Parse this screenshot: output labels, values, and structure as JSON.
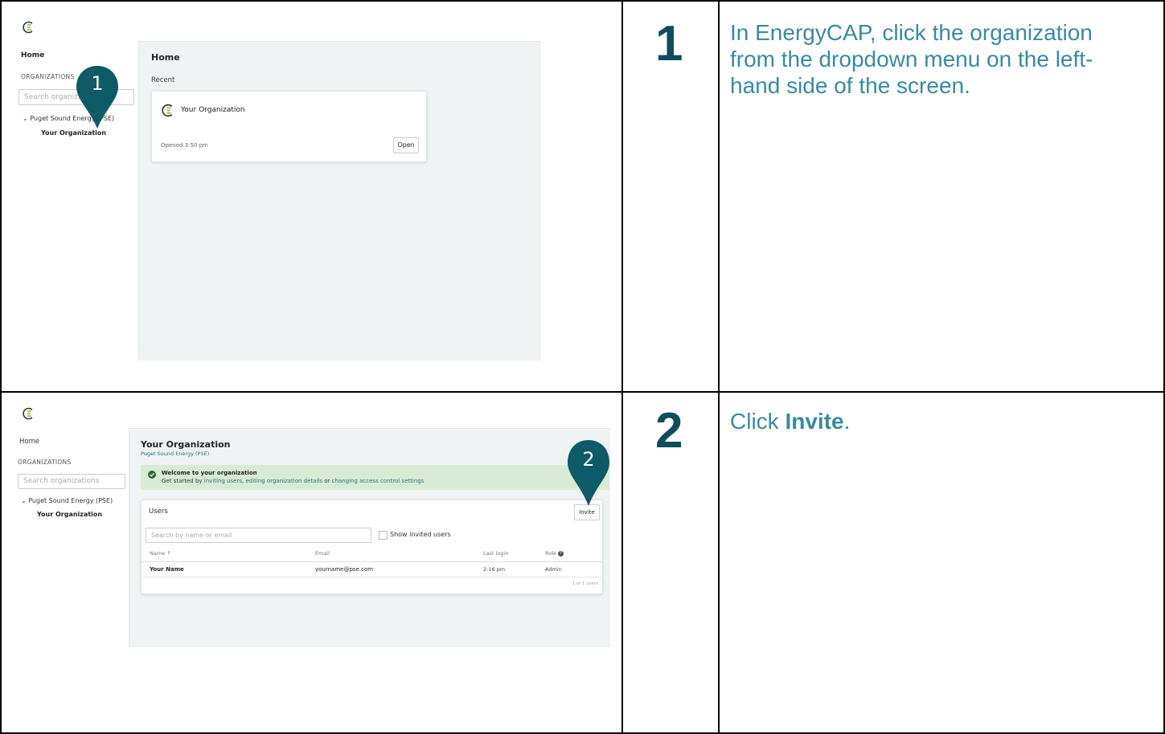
{
  "steps": [
    {
      "number": "1",
      "instruction_text": "In EnergyCAP, click the organization from the dropdown menu on the left-hand side of the screen.",
      "screenshot": {
        "sidebar": {
          "home": "Home",
          "section_label": "ORGANIZATIONS",
          "search_placeholder": "Search organizations",
          "tree_parent": "Puget Sound Energy (PSE)",
          "tree_child": "Your Organization"
        },
        "main": {
          "title": "Home",
          "recent_label": "Recent",
          "card_name": "Your Organization",
          "card_opened": "Opened 3:50 pm",
          "card_button": "Open"
        },
        "callout": "1"
      }
    },
    {
      "number": "2",
      "instruction_prefix": "Click ",
      "instruction_bold": "Invite",
      "instruction_suffix": ".",
      "screenshot": {
        "sidebar": {
          "home": "Home",
          "section_label": "ORGANIZATIONS",
          "search_placeholder": "Search organizations",
          "tree_parent": "Puget Sound Energy (PSE)",
          "tree_child": "Your Organization"
        },
        "main": {
          "title": "Your Organization",
          "subtitle": "Puget Sound Energy (PSE)",
          "alert_title": "Welcome to your organization",
          "alert_prefix": "Get started by ",
          "alert_link1": "inviting users",
          "alert_sep1": ", ",
          "alert_link2": "editing organization details",
          "alert_sep2": " or ",
          "alert_link3": "changing access control settings",
          "users_title": "Users",
          "invite_button": "Invite",
          "search_placeholder": "Search by name or email",
          "show_invited": "Show invited users",
          "columns": [
            "Name ↑",
            "Email",
            "Last login",
            "Role"
          ],
          "row": {
            "name": "Your Name",
            "email": "yourname@pse.com",
            "last_login": "2:16 pm",
            "role": "Admin"
          },
          "footer": "1 of 1 users"
        },
        "callout": "2"
      }
    }
  ],
  "colors": {
    "step_number": "#0e4d5c",
    "instruction": "#3a8aa0",
    "pin": "#0e5a66",
    "logo_green": "#8cb63c"
  }
}
